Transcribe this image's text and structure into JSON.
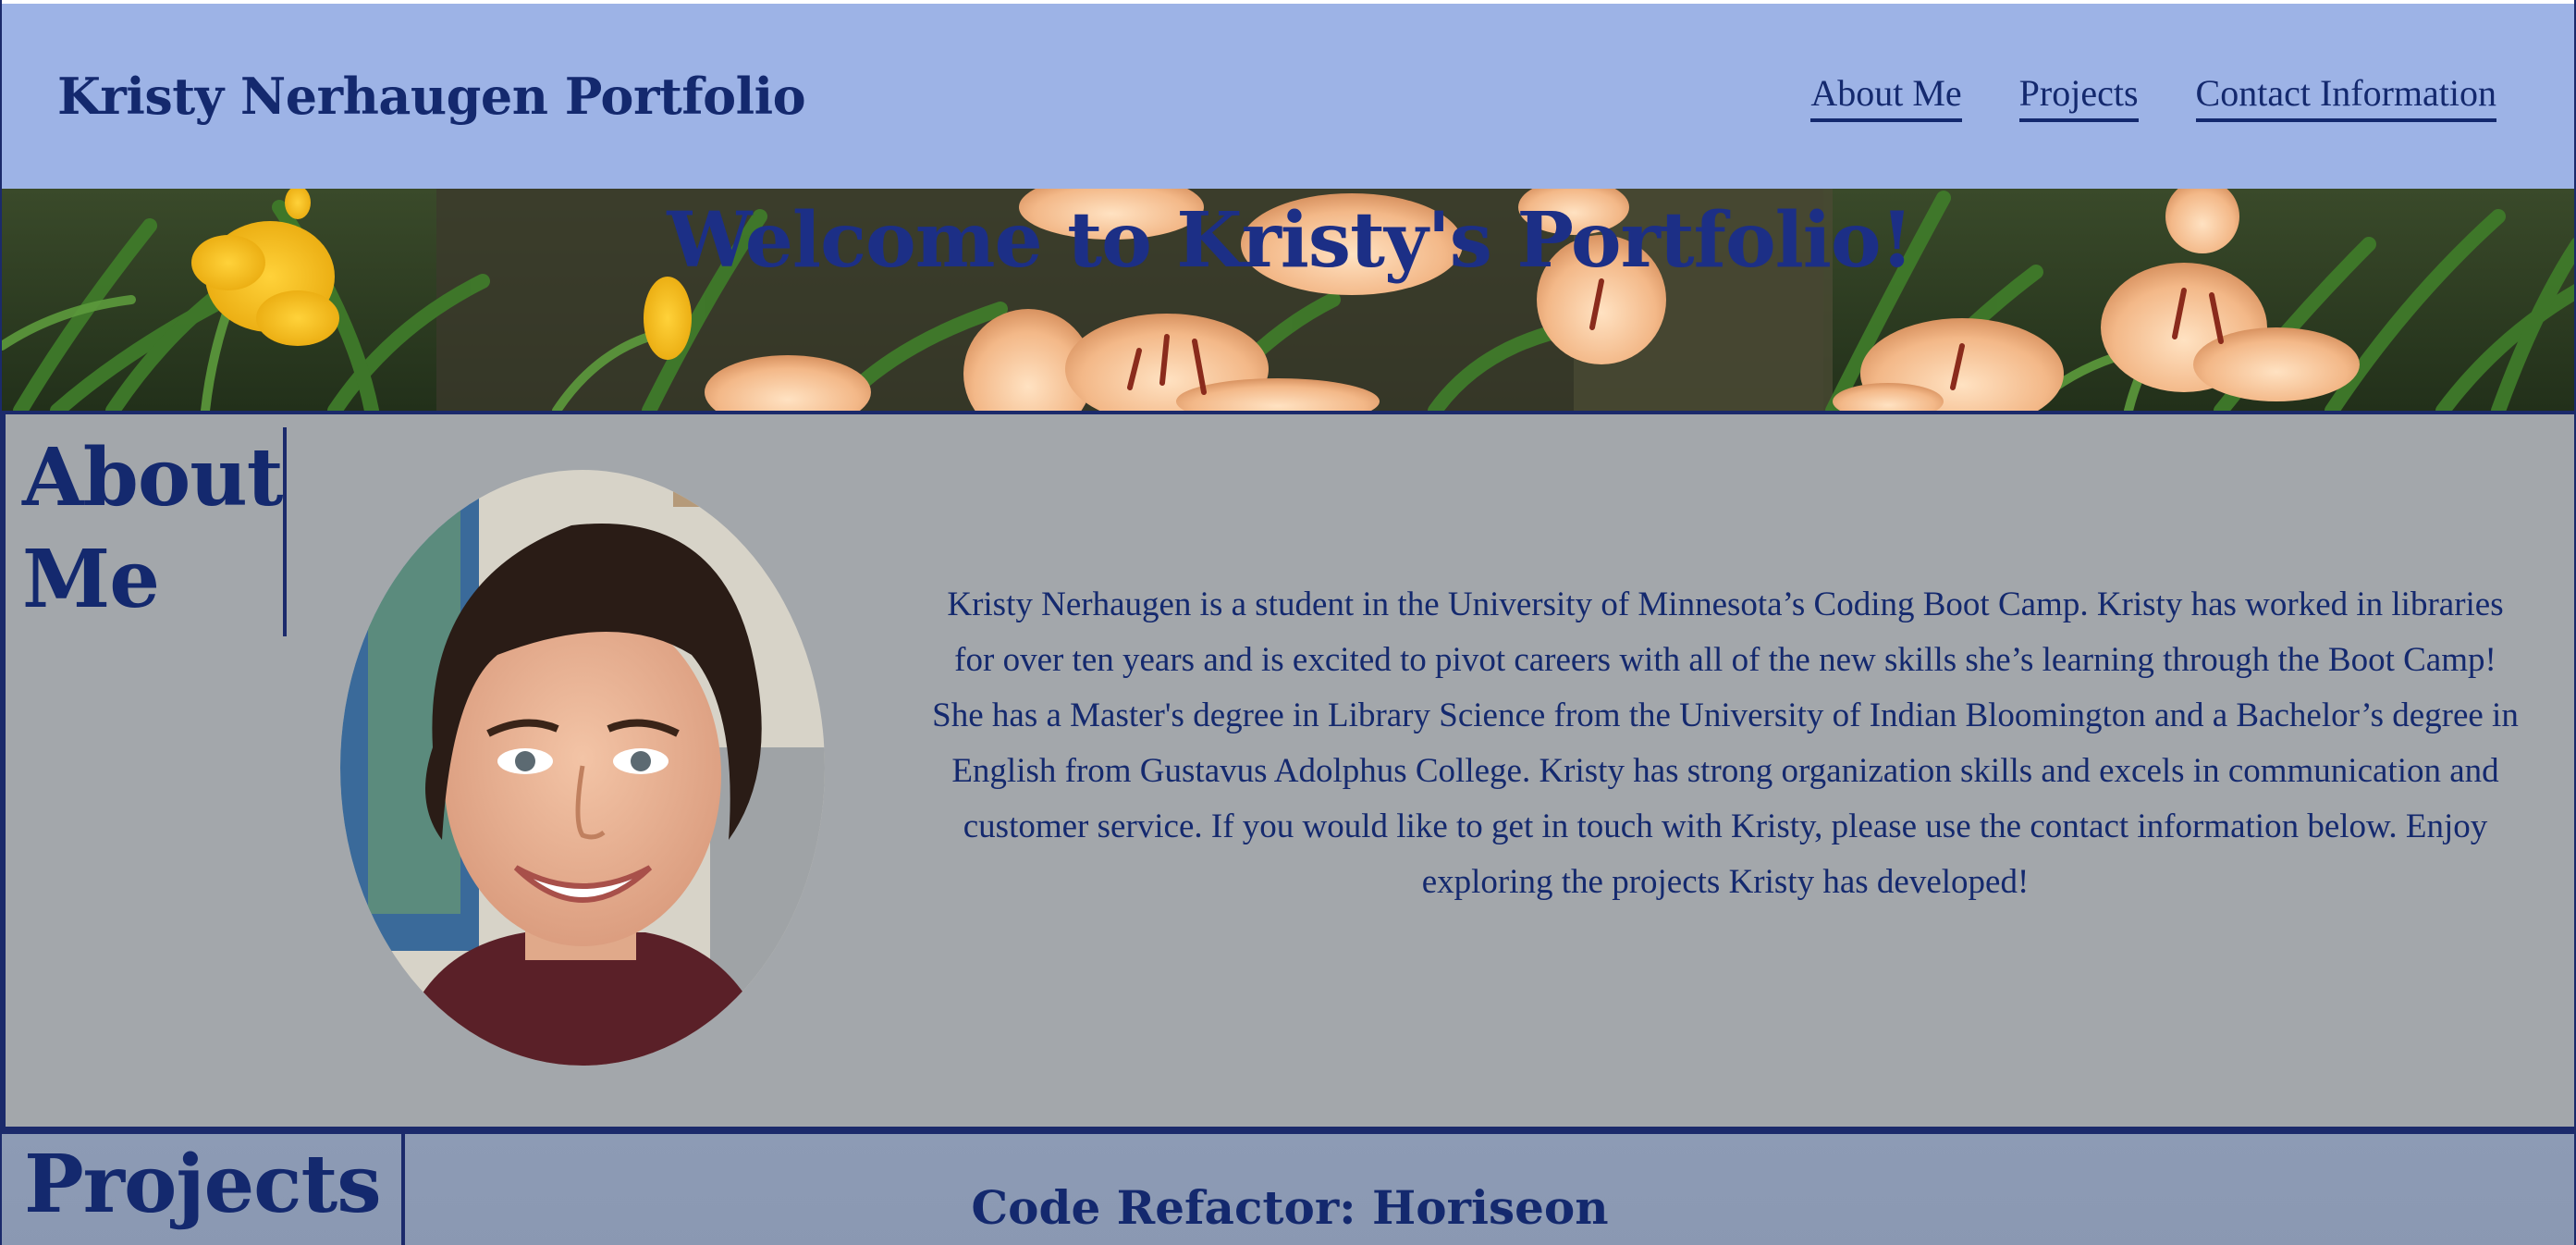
{
  "header": {
    "title": "Kristy Nerhaugen Portfolio",
    "nav": [
      {
        "label": "About Me"
      },
      {
        "label": "Projects"
      },
      {
        "label": "Contact Information"
      }
    ]
  },
  "hero": {
    "title": "Welcome to Kristy's Portfolio!"
  },
  "about": {
    "heading": "About Me",
    "text": "Kristy Nerhaugen is a student in the University of Minnesota’s Coding Boot Camp. Kristy has worked in libraries for over ten years and is excited to pivot careers with all of the new skills she’s learning through the Boot Camp! She has a Master's degree in Library Science from the University of Indian Bloomington and a Bachelor’s degree in English from Gustavus Adolphus College. Kristy has strong organization skills and excels in communication and customer service. If you would like to get in touch with Kristy, please use the contact information below. Enjoy exploring the projects Kristy has developed!"
  },
  "projects": {
    "heading": "Projects",
    "items": [
      {
        "title": "Code Refactor: Horiseon"
      }
    ]
  },
  "colors": {
    "header_bg": "#9db3e6",
    "primary_text": "#14296e",
    "about_bg": "#a3a7ab",
    "projects_bg": "#8d9bb5",
    "border": "#1b2a6b"
  },
  "icons": {
    "hero_image": "lily-flowers-photo",
    "profile_image": "profile-photo"
  }
}
